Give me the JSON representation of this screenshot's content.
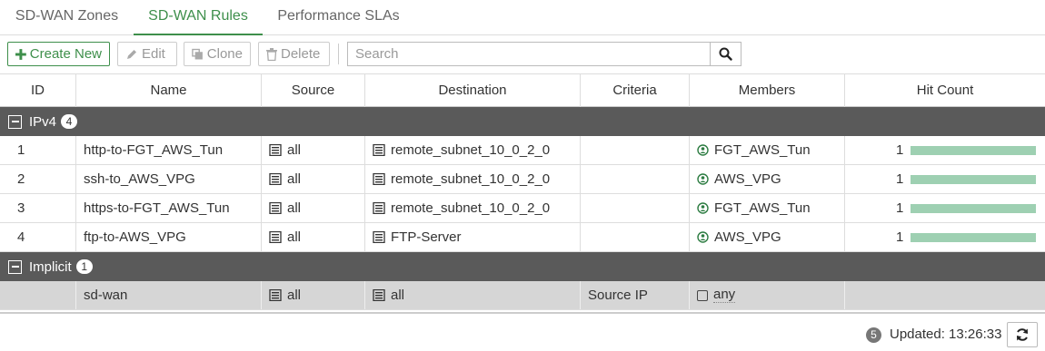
{
  "tabs": [
    {
      "label": "SD-WAN Zones"
    },
    {
      "label": "SD-WAN Rules"
    },
    {
      "label": "Performance SLAs"
    }
  ],
  "toolbar": {
    "create_label": "Create New",
    "edit_label": "Edit",
    "clone_label": "Clone",
    "delete_label": "Delete",
    "search_placeholder": "Search"
  },
  "columns": [
    "ID",
    "Name",
    "Source",
    "Destination",
    "Criteria",
    "Members",
    "Hit Count"
  ],
  "groups": [
    {
      "name": "IPv4",
      "count": "4",
      "rows": [
        {
          "id": "1",
          "name": "http-to-FGT_AWS_Tun",
          "source": "all",
          "destination": "remote_subnet_10_0_2_0",
          "criteria": "",
          "member": "FGT_AWS_Tun",
          "hit_count": "1",
          "hit_fill": 1.0
        },
        {
          "id": "2",
          "name": "ssh-to_AWS_VPG",
          "source": "all",
          "destination": "remote_subnet_10_0_2_0",
          "criteria": "",
          "member": "AWS_VPG",
          "hit_count": "1",
          "hit_fill": 1.0
        },
        {
          "id": "3",
          "name": "https-to-FGT_AWS_Tun",
          "source": "all",
          "destination": "remote_subnet_10_0_2_0",
          "criteria": "",
          "member": "FGT_AWS_Tun",
          "hit_count": "1",
          "hit_fill": 1.0
        },
        {
          "id": "4",
          "name": "ftp-to-AWS_VPG",
          "source": "all",
          "destination": "FTP-Server",
          "criteria": "",
          "member": "AWS_VPG",
          "hit_count": "1",
          "hit_fill": 1.0
        }
      ]
    },
    {
      "name": "Implicit",
      "count": "1",
      "rows": [
        {
          "id": "",
          "name": "sd-wan",
          "source": "all",
          "destination": "all",
          "criteria": "Source IP",
          "member": "any",
          "hit_count": ""
        }
      ]
    }
  ],
  "footer": {
    "total_count": "5",
    "updated_label": "Updated: 13:26:33"
  },
  "colors": {
    "accent": "#3e8f4b",
    "group_header": "#5a5a5a",
    "hit_bar": "#9ed0b2",
    "implicit_row": "#d6d6d6"
  }
}
